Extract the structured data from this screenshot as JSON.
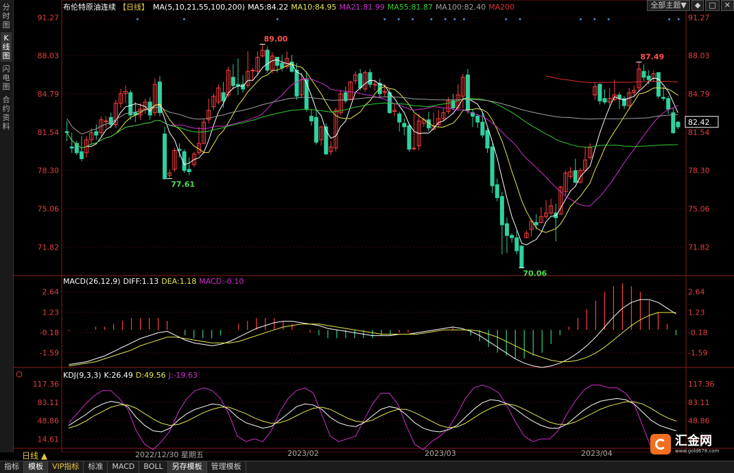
{
  "side_tabs": [
    {
      "label": "分时图",
      "active": false
    },
    {
      "label": "K线图",
      "active": true
    },
    {
      "label": "闪电图",
      "active": false
    },
    {
      "label": "合约资料",
      "active": false
    }
  ],
  "header": {
    "title": "布伦特原油连续",
    "period_tag": "【日线】",
    "ma_label": "MA(5,10,21,55,100,200)",
    "ma_items": [
      {
        "label": "MA5:84.22",
        "color": "#ffffff"
      },
      {
        "label": "MA10:84.95",
        "color": "#e8e850"
      },
      {
        "label": "MA21:81.99",
        "color": "#d030d0"
      },
      {
        "label": "MA55:81.87",
        "color": "#30d030"
      },
      {
        "label": "MA100:82.40",
        "color": "#a0a0a0"
      },
      {
        "label": "MA200",
        "color": "#e03030"
      }
    ]
  },
  "toolbar": {
    "theme_select": "全部主题▼",
    "btn1": "◆",
    "btn2": "□",
    "btn3": "✕"
  },
  "macd_header": {
    "label": "MACD(26,12,9)",
    "diff": "DIFF:1.13",
    "dea": "DEA:1.18",
    "macd": "MACD:-0.10"
  },
  "kdj_header": {
    "label": "KDJ(9,3,3)",
    "k": "K:26.49",
    "d": "D:49.56",
    "j": "J:-19.63"
  },
  "x_axis": {
    "labels": [
      "2022/12/30 星期五",
      "2023/02",
      "2023/03",
      "2023/04"
    ]
  },
  "period_button": "日线 ▲",
  "bottom_tabs": [
    "指标",
    "模板",
    "VIP指标",
    "标准",
    "MACD",
    "BOLL",
    "另存模板",
    "管理模板"
  ],
  "logo": {
    "name": "汇金网",
    "url": "www.gold678.com"
  },
  "chart_data": {
    "type": "candlestick",
    "price_axis": {
      "ticks": [
        91.27,
        88.03,
        84.79,
        81.54,
        78.3,
        75.06,
        71.82
      ],
      "ylim": [
        69.4,
        91.7
      ]
    },
    "last_price": "82.42",
    "annotations": [
      {
        "label": "89.00",
        "color": "#ff5050"
      },
      {
        "label": "77.61",
        "color": "#50e050"
      },
      {
        "label": "70.06",
        "color": "#50e050"
      },
      {
        "label": "87.49",
        "color": "#ff5050"
      }
    ],
    "candles": [
      [
        81.6,
        81.5,
        82.5,
        80.8
      ],
      [
        80.3,
        80.2,
        81.5,
        79.8
      ],
      [
        80.6,
        79.8,
        80.8,
        79.6
      ],
      [
        79.9,
        79.3,
        81.2,
        79.1
      ],
      [
        79.8,
        80.9,
        81.2,
        79.4
      ],
      [
        80.9,
        81.5,
        81.9,
        80.5
      ],
      [
        81.6,
        81.3,
        82.2,
        80.9
      ],
      [
        81.5,
        82.6,
        82.9,
        81.2
      ],
      [
        82.5,
        82.5,
        82.9,
        81.9
      ],
      [
        82.8,
        82.2,
        83.2,
        81.9
      ],
      [
        82.2,
        84.0,
        84.3,
        81.9
      ],
      [
        84.0,
        84.8,
        85.2,
        83.6
      ],
      [
        84.8,
        85.0,
        85.5,
        84.0
      ],
      [
        84.9,
        83.0,
        85.1,
        82.6
      ],
      [
        83.2,
        83.0,
        84.1,
        82.4
      ],
      [
        83.0,
        83.5,
        84.0,
        82.6
      ],
      [
        83.5,
        84.1,
        84.4,
        83.1
      ],
      [
        84.1,
        83.0,
        84.5,
        82.6
      ],
      [
        83.2,
        85.6,
        86.1,
        82.9
      ],
      [
        85.8,
        83.2,
        86.3,
        82.9
      ],
      [
        81.4,
        77.6,
        82.0,
        77.5
      ],
      [
        77.9,
        78.1,
        78.4,
        77.6
      ],
      [
        78.4,
        80.0,
        80.2,
        78.2
      ],
      [
        80.1,
        80.0,
        80.6,
        79.4
      ],
      [
        79.9,
        78.3,
        80.1,
        78.1
      ],
      [
        78.4,
        78.2,
        79.4,
        77.9
      ],
      [
        78.8,
        79.7,
        79.9,
        78.6
      ],
      [
        79.8,
        80.6,
        82.0,
        79.6
      ],
      [
        80.6,
        82.4,
        82.7,
        80.5
      ],
      [
        82.6,
        83.4,
        84.4,
        82.3
      ],
      [
        83.7,
        84.6,
        84.8,
        83.4
      ],
      [
        84.1,
        85.3,
        85.6,
        83.9
      ],
      [
        84.9,
        84.2,
        85.8,
        83.6
      ],
      [
        84.7,
        86.8,
        87.1,
        84.5
      ],
      [
        86.2,
        85.5,
        87.3,
        85.2
      ],
      [
        85.6,
        85.5,
        87.8,
        84.7
      ],
      [
        85.6,
        85.2,
        86.4,
        84.9
      ],
      [
        85.5,
        86.7,
        88.4,
        85.3
      ],
      [
        86.8,
        86.8,
        87.0,
        85.9
      ],
      [
        86.7,
        87.9,
        88.4,
        86.4
      ],
      [
        88.0,
        88.5,
        89.0,
        87.9
      ],
      [
        88.5,
        86.8,
        88.8,
        86.6
      ],
      [
        86.8,
        88.0,
        88.3,
        86.5
      ],
      [
        87.9,
        87.2,
        87.9,
        86.6
      ],
      [
        87.4,
        87.0,
        88.1,
        86.7
      ],
      [
        87.1,
        87.8,
        88.4,
        86.9
      ],
      [
        87.5,
        86.7,
        88.1,
        86.6
      ],
      [
        86.8,
        84.6,
        87.4,
        84.3
      ],
      [
        84.7,
        86.0,
        86.6,
        84.5
      ],
      [
        86.0,
        83.5,
        86.7,
        83.3
      ],
      [
        82.9,
        82.5,
        83.5,
        82.1
      ],
      [
        82.8,
        80.7,
        83.4,
        80.5
      ],
      [
        80.9,
        82.0,
        82.1,
        80.4
      ],
      [
        82.0,
        79.7,
        82.3,
        79.6
      ],
      [
        79.9,
        80.3,
        80.8,
        79.6
      ],
      [
        80.2,
        83.4,
        83.6,
        79.9
      ],
      [
        83.2,
        84.8,
        85.1,
        83.0
      ],
      [
        84.9,
        84.2,
        85.4,
        84.0
      ],
      [
        84.3,
        85.8,
        85.9,
        84.2
      ],
      [
        85.9,
        86.4,
        86.7,
        85.6
      ],
      [
        86.5,
        85.3,
        86.9,
        85.1
      ],
      [
        85.2,
        86.6,
        86.8,
        85.0
      ],
      [
        86.6,
        85.6,
        86.9,
        85.3
      ],
      [
        85.6,
        85.6,
        86.0,
        85.1
      ],
      [
        85.7,
        84.8,
        86.1,
        84.5
      ],
      [
        84.9,
        85.0,
        85.6,
        84.6
      ],
      [
        84.9,
        83.2,
        85.2,
        83.1
      ],
      [
        83.3,
        83.4,
        84.0,
        82.9
      ],
      [
        83.1,
        82.4,
        83.3,
        81.6
      ],
      [
        82.3,
        82.0,
        82.7,
        81.3
      ],
      [
        82.1,
        80.1,
        82.3,
        79.9
      ],
      [
        80.2,
        80.2,
        83.1,
        80.0
      ],
      [
        80.4,
        82.5,
        83.1,
        80.0
      ],
      [
        82.3,
        82.6,
        82.8,
        82.0
      ],
      [
        82.6,
        81.9,
        83.3,
        81.6
      ],
      [
        81.8,
        82.1,
        83.2,
        81.7
      ],
      [
        82.2,
        82.7,
        83.4,
        82.0
      ],
      [
        82.7,
        83.2,
        83.6,
        82.5
      ],
      [
        83.3,
        84.2,
        84.5,
        83.1
      ],
      [
        84.2,
        83.6,
        84.8,
        83.4
      ],
      [
        83.6,
        84.7,
        85.6,
        83.4
      ],
      [
        84.6,
        86.2,
        86.5,
        83.6
      ],
      [
        86.4,
        83.4,
        86.9,
        83.1
      ],
      [
        83.2,
        82.9,
        83.5,
        82.0
      ],
      [
        82.9,
        82.4,
        83.1,
        81.9
      ],
      [
        82.4,
        81.3,
        83.3,
        81.1
      ],
      [
        81.7,
        80.2,
        81.9,
        79.8
      ],
      [
        80.3,
        77.0,
        80.6,
        76.4
      ],
      [
        77.1,
        76.0,
        77.6,
        75.7
      ],
      [
        76.1,
        73.7,
        76.5,
        71.2
      ],
      [
        73.8,
        72.8,
        74.3,
        71.3
      ],
      [
        72.8,
        72.6,
        73.0,
        72.2
      ],
      [
        72.6,
        71.5,
        73.2,
        71.2
      ],
      [
        71.9,
        70.1,
        72.0,
        70.1
      ],
      [
        72.6,
        73.0,
        73.2,
        72.6
      ],
      [
        73.3,
        74.0,
        74.2,
        72.7
      ],
      [
        73.9,
        73.7,
        74.6,
        73.3
      ],
      [
        73.9,
        74.4,
        75.2,
        73.8
      ],
      [
        74.4,
        74.7,
        75.8,
        74.2
      ],
      [
        74.7,
        75.3,
        75.9,
        74.5
      ],
      [
        74.7,
        74.3,
        75.5,
        72.3
      ],
      [
        74.6,
        76.9,
        77.0,
        74.6
      ],
      [
        76.5,
        78.1,
        78.3,
        76.2
      ],
      [
        77.8,
        78.2,
        78.6,
        77.6
      ],
      [
        78.3,
        77.3,
        79.3,
        77.2
      ],
      [
        77.3,
        78.3,
        78.5,
        77.2
      ],
      [
        78.3,
        79.2,
        80.3,
        78.2
      ],
      [
        79.4,
        80.3,
        80.6,
        79.2
      ],
      [
        84.7,
        85.4,
        85.7,
        84.3
      ],
      [
        85.6,
        84.2,
        85.7,
        83.9
      ],
      [
        84.4,
        84.1,
        85.2,
        83.9
      ],
      [
        84.1,
        84.4,
        85.3,
        83.8
      ],
      [
        84.3,
        84.7,
        86.0,
        84.2
      ],
      [
        84.7,
        84.4,
        84.9,
        83.5
      ],
      [
        84.4,
        83.8,
        84.6,
        83.5
      ],
      [
        83.8,
        84.9,
        85.3,
        83.6
      ],
      [
        84.9,
        85.1,
        85.5,
        84.6
      ],
      [
        85.3,
        86.9,
        87.5,
        85.0
      ],
      [
        86.7,
        86.2,
        87.3,
        85.9
      ],
      [
        86.3,
        86.0,
        86.8,
        85.6
      ],
      [
        86.1,
        86.5,
        86.8,
        85.8
      ],
      [
        86.6,
        84.6,
        86.6,
        84.4
      ],
      [
        84.5,
        84.4,
        85.4,
        84.2
      ],
      [
        84.4,
        83.5,
        84.6,
        83.1
      ],
      [
        83.2,
        81.5,
        83.6,
        81.4
      ],
      [
        82.4,
        82.0,
        82.5,
        81.8
      ]
    ],
    "ma_series": [
      {
        "name": "MA5",
        "color": "#ffffff"
      },
      {
        "name": "MA10",
        "color": "#e8e850"
      },
      {
        "name": "MA21",
        "color": "#d030d0"
      },
      {
        "name": "MA55",
        "color": "#30d030"
      },
      {
        "name": "MA100",
        "color": "#a0a0a0"
      },
      {
        "name": "MA200",
        "color": "#e03030"
      }
    ],
    "macd": {
      "ticks": [
        2.64,
        1.23,
        -0.18,
        -1.59
      ],
      "ylim": [
        -2.6,
        3.0
      ],
      "diff_color": "#ffffff",
      "dea_color": "#e8e850",
      "diff": [
        -2.4,
        -2.3,
        -2.2,
        -2.0,
        -1.8,
        -1.5,
        -1.2,
        -0.9,
        -0.6,
        -0.4,
        -0.2,
        -0.1,
        -0.4,
        -0.7,
        -0.9,
        -1.0,
        -1.1,
        -1.0,
        -0.8,
        -0.5,
        -0.2,
        0.1,
        0.3,
        0.5,
        0.6,
        0.6,
        0.5,
        0.4,
        0.3,
        0.1,
        0.0,
        -0.1,
        -0.2,
        -0.3,
        -0.4,
        -0.4,
        -0.4,
        -0.3,
        -0.3,
        -0.2,
        -0.1,
        0.0,
        0.1,
        0.2,
        0.1,
        -0.1,
        -0.4,
        -0.8,
        -1.2,
        -1.6,
        -2.0,
        -2.3,
        -2.5,
        -2.6,
        -2.5,
        -2.3,
        -2.0,
        -1.6,
        -1.1,
        -0.5,
        0.2,
        0.9,
        1.5,
        1.9,
        2.1,
        2.1,
        1.9,
        1.5,
        1.1
      ],
      "dea": [
        -2.5,
        -2.4,
        -2.3,
        -2.2,
        -2.0,
        -1.8,
        -1.6,
        -1.4,
        -1.1,
        -0.9,
        -0.7,
        -0.5,
        -0.5,
        -0.6,
        -0.7,
        -0.8,
        -0.9,
        -0.9,
        -0.9,
        -0.8,
        -0.6,
        -0.4,
        -0.2,
        0.0,
        0.2,
        0.3,
        0.4,
        0.4,
        0.4,
        0.3,
        0.2,
        0.1,
        0.0,
        -0.1,
        -0.2,
        -0.3,
        -0.3,
        -0.3,
        -0.3,
        -0.3,
        -0.2,
        -0.1,
        0.0,
        0.0,
        0.0,
        0.0,
        -0.1,
        -0.3,
        -0.5,
        -0.8,
        -1.1,
        -1.4,
        -1.7,
        -1.9,
        -2.1,
        -2.2,
        -2.2,
        -2.1,
        -1.9,
        -1.6,
        -1.2,
        -0.7,
        -0.2,
        0.3,
        0.7,
        1.0,
        1.2,
        1.2,
        1.2
      ],
      "hist": [
        0.1,
        0.2,
        0.2,
        0.4,
        0.4,
        0.6,
        0.8,
        1.0,
        1.0,
        1.0,
        1.0,
        0.8,
        0.2,
        -0.2,
        -0.4,
        -0.4,
        -0.4,
        -0.2,
        0.2,
        0.6,
        0.8,
        1.0,
        1.0,
        1.0,
        0.8,
        0.6,
        0.2,
        0.0,
        -0.2,
        -0.4,
        -0.4,
        -0.4,
        -0.4,
        -0.4,
        -0.4,
        -0.2,
        -0.2,
        0.0,
        0.0,
        0.2,
        0.2,
        0.2,
        0.2,
        0.4,
        0.2,
        -0.2,
        -0.6,
        -1.0,
        -1.4,
        -1.6,
        -1.8,
        -1.8,
        -1.6,
        -1.4,
        -0.8,
        -0.2,
        0.4,
        1.0,
        1.6,
        2.2,
        2.8,
        3.2,
        3.4,
        3.2,
        2.8,
        2.2,
        1.4,
        0.6,
        -0.2
      ]
    },
    "kdj": {
      "ticks": [
        117.36,
        83.11,
        48.86,
        14.61
      ],
      "ylim": [
        0,
        125
      ],
      "k_color": "#ffffff",
      "d_color": "#e8e850",
      "j_color": "#d030d0",
      "k": [
        40,
        50,
        60,
        72,
        80,
        85,
        82,
        75,
        55,
        40,
        30,
        28,
        35,
        50,
        62,
        70,
        75,
        80,
        78,
        70,
        55,
        45,
        40,
        35,
        38,
        50,
        62,
        75,
        80,
        78,
        70,
        55,
        45,
        40,
        38,
        45,
        58,
        70,
        75,
        72,
        60,
        45,
        35,
        30,
        28,
        32,
        40,
        55,
        70,
        82,
        88,
        86,
        80,
        70,
        58,
        48,
        40,
        35,
        35,
        42,
        55,
        68,
        78,
        85,
        88,
        90,
        88,
        80,
        65,
        50,
        40,
        35,
        30
      ],
      "d": [
        35,
        40,
        48,
        58,
        66,
        74,
        78,
        78,
        72,
        62,
        52,
        44,
        40,
        42,
        48,
        56,
        64,
        70,
        74,
        74,
        68,
        62,
        54,
        48,
        44,
        45,
        50,
        58,
        66,
        72,
        74,
        70,
        62,
        54,
        48,
        46,
        50,
        58,
        65,
        70,
        70,
        64,
        56,
        48,
        40,
        36,
        37,
        44,
        54,
        64,
        72,
        78,
        80,
        77,
        70,
        62,
        54,
        46,
        42,
        42,
        46,
        54,
        62,
        70,
        76,
        80,
        84,
        84,
        80,
        72,
        62,
        54,
        48
      ],
      "j": [
        45,
        62,
        80,
        95,
        105,
        105,
        90,
        70,
        30,
        5,
        -5,
        10,
        30,
        65,
        90,
        105,
        110,
        105,
        90,
        60,
        20,
        10,
        15,
        10,
        30,
        65,
        90,
        105,
        110,
        100,
        60,
        20,
        10,
        15,
        20,
        50,
        80,
        100,
        100,
        80,
        40,
        5,
        -5,
        10,
        20,
        35,
        60,
        90,
        110,
        115,
        110,
        100,
        75,
        45,
        20,
        10,
        15,
        15,
        30,
        60,
        85,
        105,
        115,
        115,
        110,
        110,
        100,
        80,
        40,
        0,
        -10,
        -15,
        -19.63
      ]
    }
  }
}
